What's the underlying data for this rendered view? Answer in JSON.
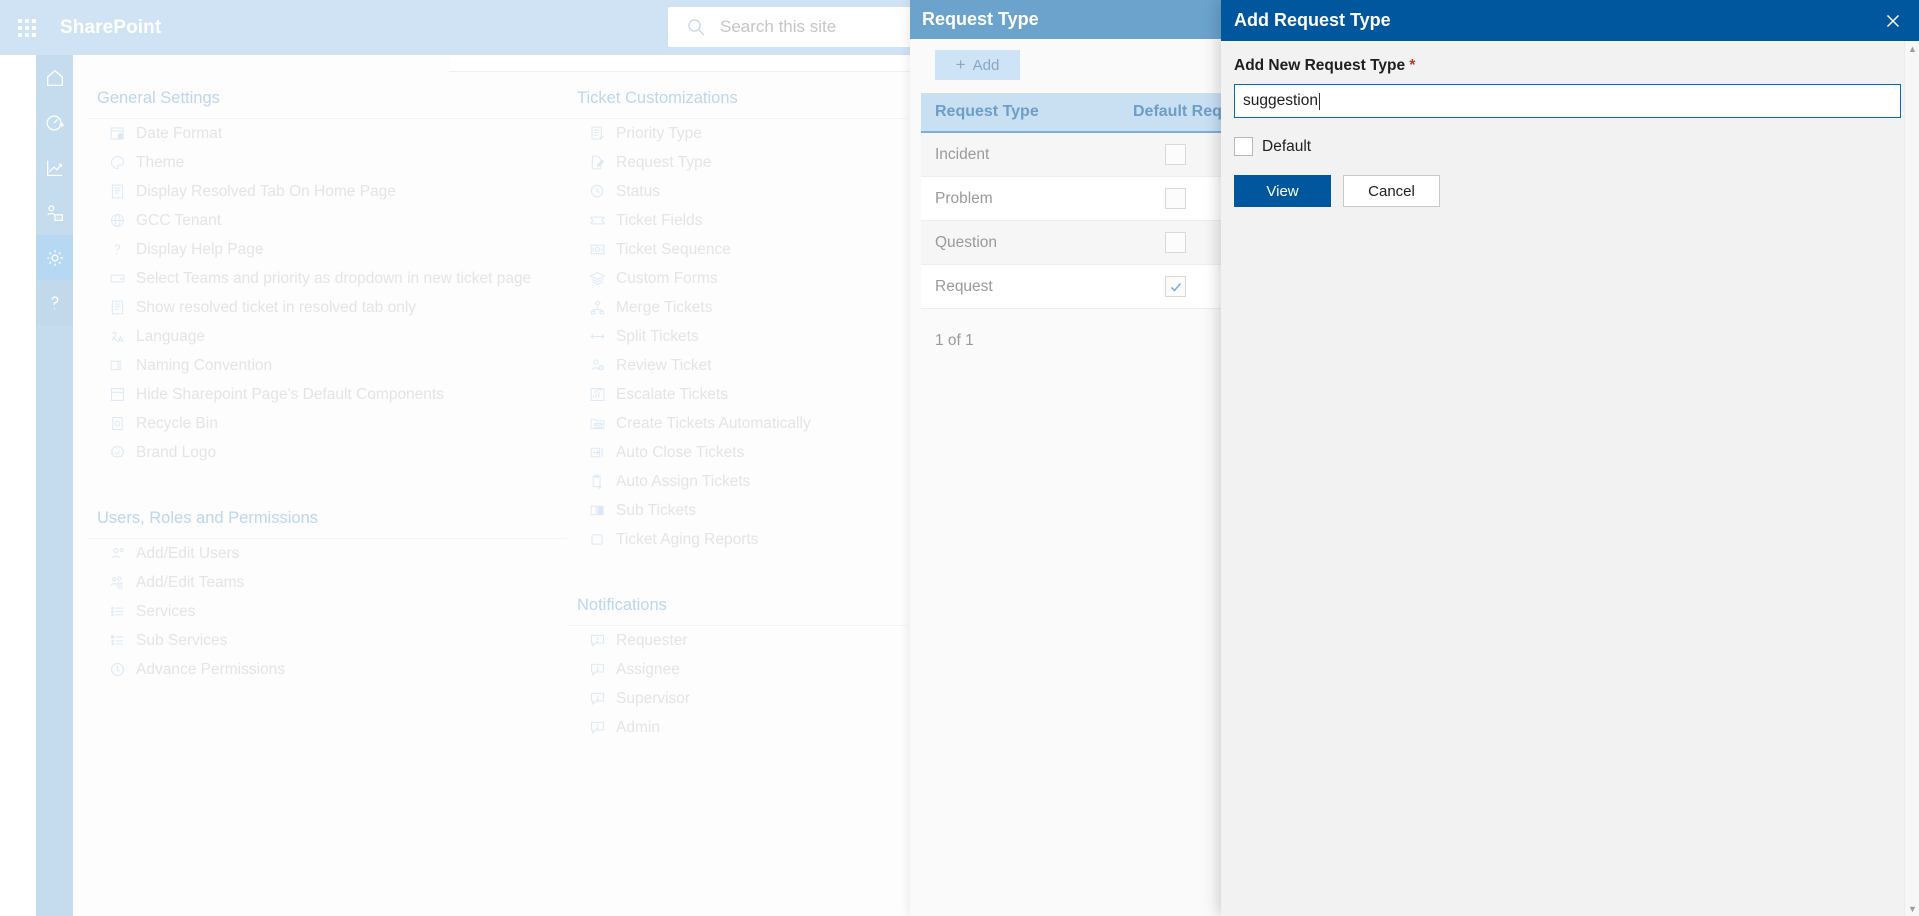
{
  "suite_bar": {
    "waffle_icon": "app-launcher-icon",
    "brand": "SharePoint",
    "search_icon": "search-icon",
    "search_placeholder": "Search this site"
  },
  "rail": {
    "items": [
      {
        "icon": "home-icon",
        "name": "home"
      },
      {
        "icon": "dashboard-icon",
        "name": "dashboard"
      },
      {
        "icon": "analytics-icon",
        "name": "analytics"
      },
      {
        "icon": "teams-icon",
        "name": "teams"
      },
      {
        "icon": "gear-icon",
        "name": "settings",
        "active": true
      },
      {
        "icon": "help-icon",
        "name": "help"
      }
    ]
  },
  "settings": {
    "groups": [
      {
        "title": "General Settings",
        "items": [
          {
            "label": "Date Format",
            "icon": "calendar-clock-icon"
          },
          {
            "label": "Theme",
            "icon": "palette-icon"
          },
          {
            "label": "Display Resolved Tab On Home Page",
            "icon": "document-icon"
          },
          {
            "label": "GCC Tenant",
            "icon": "globe-icon"
          },
          {
            "label": "Display Help Page",
            "icon": "question-icon"
          },
          {
            "label": "Select Teams and priority as dropdown in new ticket page",
            "icon": "dropdown-icon"
          },
          {
            "label": "Show resolved ticket in resolved tab only",
            "icon": "document-icon"
          },
          {
            "label": "Language",
            "icon": "translate-icon"
          },
          {
            "label": "Naming Convention",
            "icon": "rename-icon"
          },
          {
            "label": "Hide Sharepoint Page's Default Components",
            "icon": "layout-icon"
          },
          {
            "label": "Recycle Bin",
            "icon": "recycle-bin-icon"
          },
          {
            "label": "Brand Logo",
            "icon": "badge-icon"
          }
        ]
      },
      {
        "title": "Users, Roles and Permissions",
        "items": [
          {
            "label": "Add/Edit Users",
            "icon": "people-icon"
          },
          {
            "label": "Add/Edit Teams",
            "icon": "people-team-icon"
          },
          {
            "label": "Services",
            "icon": "list-icon"
          },
          {
            "label": "Sub Services",
            "icon": "sub-list-icon"
          },
          {
            "label": "Advance Permissions",
            "icon": "shield-icon"
          }
        ]
      }
    ],
    "groups2": [
      {
        "title": "Ticket Customizations",
        "items": [
          {
            "label": "Priority Type",
            "icon": "priority-icon"
          },
          {
            "label": "Request Type",
            "icon": "edit-document-icon"
          },
          {
            "label": "Status",
            "icon": "clock-check-icon"
          },
          {
            "label": "Ticket Fields",
            "icon": "ticket-icon"
          },
          {
            "label": "Ticket Sequence",
            "icon": "sequence-icon"
          },
          {
            "label": "Custom Forms",
            "icon": "layers-icon"
          },
          {
            "label": "Merge Tickets",
            "icon": "merge-icon"
          },
          {
            "label": "Split Tickets",
            "icon": "split-icon"
          },
          {
            "label": "Review Ticket",
            "icon": "person-review-icon"
          },
          {
            "label": "Escalate Tickets",
            "icon": "escalate-chart-icon"
          },
          {
            "label": "Create Tickets Automatically",
            "icon": "mail-folder-icon"
          },
          {
            "label": "Auto Close Tickets",
            "icon": "close-arrow-icon"
          },
          {
            "label": "Auto Assign Tickets",
            "icon": "clipboard-arrow-icon"
          },
          {
            "label": "Sub Tickets",
            "icon": "panels-icon"
          },
          {
            "label": "Ticket Aging Reports",
            "icon": "square-icon"
          }
        ]
      },
      {
        "title": "Notifications",
        "items": [
          {
            "label": "Requester",
            "icon": "comment-icon"
          },
          {
            "label": "Assignee",
            "icon": "comment-icon"
          },
          {
            "label": "Supervisor",
            "icon": "comment-icon"
          },
          {
            "label": "Admin",
            "icon": "comment-icon"
          }
        ]
      }
    ]
  },
  "request_type_panel": {
    "title": "Request Type",
    "add_button": "Add",
    "add_icon": "plus-icon",
    "columns": [
      "Request Type",
      "Default Request Type"
    ],
    "rows": [
      {
        "request_type": "Incident",
        "default": false
      },
      {
        "request_type": "Problem",
        "default": false
      },
      {
        "request_type": "Question",
        "default": false
      },
      {
        "request_type": "Request",
        "default": true
      }
    ],
    "pager": "1 of 1"
  },
  "dialog": {
    "title": "Add Request Type",
    "close_icon": "close-icon",
    "field_label": "Add New Request Type",
    "required_mark": "*",
    "input_value": "suggestion",
    "checkbox_label": "Default",
    "checkbox_checked": false,
    "primary_button": "View",
    "secondary_button": "Cancel"
  },
  "colors": {
    "dialog_header": "#00579e",
    "panel_header": "#6ba3cd",
    "table_header": "#c9e0f3",
    "accent": "#0a68b8"
  }
}
